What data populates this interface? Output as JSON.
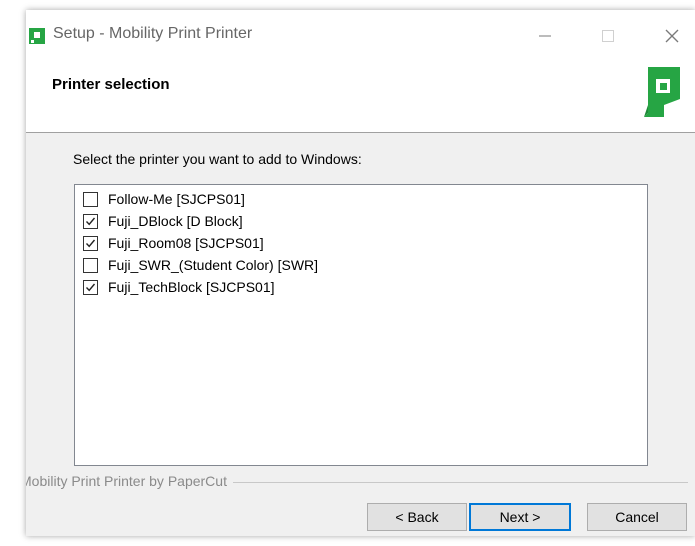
{
  "window": {
    "title": "Setup - Mobility Print Printer"
  },
  "header": {
    "title": "Printer selection"
  },
  "instruction": "Select the printer you want to add to Windows:",
  "printers": [
    {
      "label": "Follow-Me [SJCPS01]",
      "checked": false
    },
    {
      "label": "Fuji_DBlock [D Block]",
      "checked": true
    },
    {
      "label": "Fuji_Room08 [SJCPS01]",
      "checked": true
    },
    {
      "label": "Fuji_SWR_(Student Color) [SWR]",
      "checked": false
    },
    {
      "label": "Fuji_TechBlock [SJCPS01]",
      "checked": true
    }
  ],
  "footer": {
    "brand": "Mobility Print Printer by PaperCut"
  },
  "buttons": {
    "back": "< Back",
    "next": "Next >",
    "cancel": "Cancel"
  },
  "colors": {
    "brand_green": "#26a544",
    "focus_blue": "#0078d7"
  },
  "icons": {
    "app": "papercut-icon",
    "minimize": "minimize-icon",
    "maximize": "maximize-icon",
    "close": "close-icon",
    "brand": "papercut-logo-icon",
    "check": "checkmark-icon"
  }
}
